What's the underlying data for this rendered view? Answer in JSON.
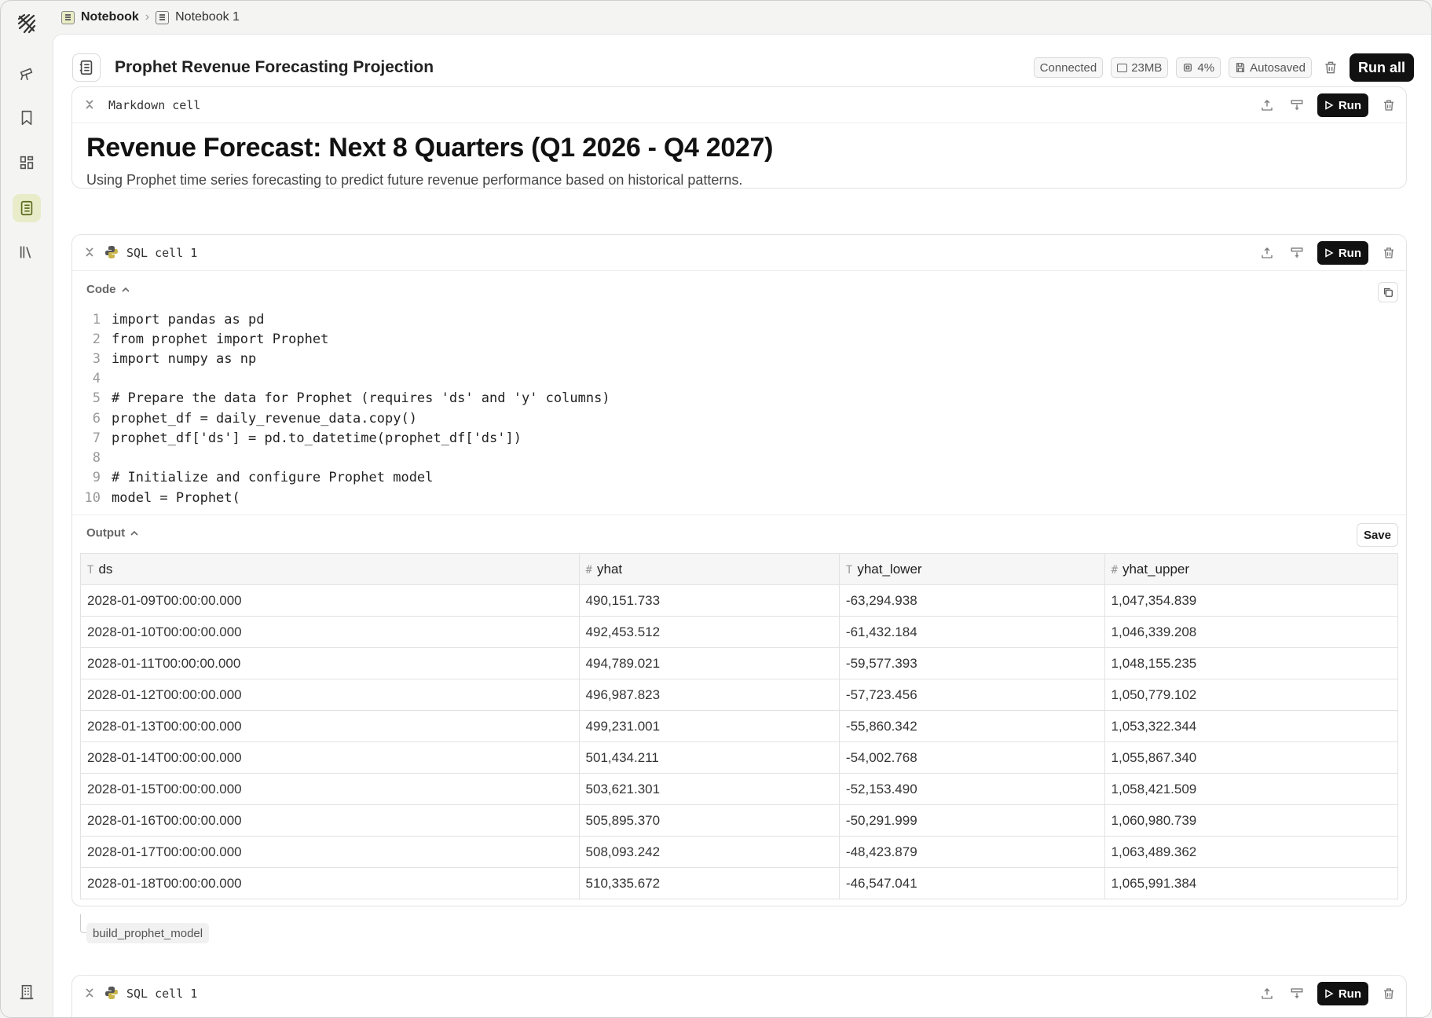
{
  "breadcrumb": {
    "root": "Notebook",
    "current": "Notebook 1"
  },
  "sidebar": {
    "items": [
      {
        "name": "telescope",
        "active": false
      },
      {
        "name": "bookmark",
        "active": false
      },
      {
        "name": "dashboard",
        "active": false
      },
      {
        "name": "notebook",
        "active": true
      },
      {
        "name": "library",
        "active": false
      }
    ],
    "bottom": "building"
  },
  "header": {
    "title": "Prophet Revenue Forecasting Projection",
    "status": "Connected",
    "memory": "23MB",
    "cpu": "4%",
    "save_state": "Autosaved",
    "run_all": "Run all"
  },
  "markdown_cell": {
    "name": "Markdown cell",
    "run": "Run",
    "heading": "Revenue Forecast: Next 8 Quarters (Q1 2026 - Q4 2027)",
    "paragraph": "Using Prophet time series forecasting to predict future revenue performance based on historical patterns."
  },
  "sql_cell": {
    "name": "SQL cell 1",
    "run": "Run",
    "code_label": "Code",
    "output_label": "Output",
    "save": "Save",
    "code": [
      {
        "n": "1",
        "t": "import pandas as pd"
      },
      {
        "n": "2",
        "t": "from prophet import Prophet"
      },
      {
        "n": "3",
        "t": "import numpy as np"
      },
      {
        "n": "4",
        "t": ""
      },
      {
        "n": "5",
        "t": "# Prepare the data for Prophet (requires 'ds' and 'y' columns)"
      },
      {
        "n": "6",
        "t": "prophet_df = daily_revenue_data.copy()"
      },
      {
        "n": "7",
        "t": "prophet_df['ds'] = pd.to_datetime(prophet_df['ds'])"
      },
      {
        "n": "8",
        "t": ""
      },
      {
        "n": "9",
        "t": "# Initialize and configure Prophet model"
      },
      {
        "n": "10",
        "t": "model = Prophet("
      }
    ],
    "columns": [
      {
        "type": "T",
        "name": "ds"
      },
      {
        "type": "#",
        "name": "yhat"
      },
      {
        "type": "T",
        "name": "yhat_lower"
      },
      {
        "type": "#",
        "name": "yhat_upper"
      }
    ],
    "rows": [
      [
        "2028-01-09T00:00:00.000",
        "490,151.733",
        "-63,294.938",
        "1,047,354.839"
      ],
      [
        "2028-01-10T00:00:00.000",
        "492,453.512",
        "-61,432.184",
        "1,046,339.208"
      ],
      [
        "2028-01-11T00:00:00.000",
        "494,789.021",
        "-59,577.393",
        "1,048,155.235"
      ],
      [
        "2028-01-12T00:00:00.000",
        "496,987.823",
        "-57,723.456",
        "1,050,779.102"
      ],
      [
        "2028-01-13T00:00:00.000",
        "499,231.001",
        "-55,860.342",
        "1,053,322.344"
      ],
      [
        "2028-01-14T00:00:00.000",
        "501,434.211",
        "-54,002.768",
        "1,055,867.340"
      ],
      [
        "2028-01-15T00:00:00.000",
        "503,621.301",
        "-52,153.490",
        "1,058,421.509"
      ],
      [
        "2028-01-16T00:00:00.000",
        "505,895.370",
        "-50,291.999",
        "1,060,980.739"
      ],
      [
        "2028-01-17T00:00:00.000",
        "508,093.242",
        "-48,423.879",
        "1,063,489.362"
      ],
      [
        "2028-01-18T00:00:00.000",
        "510,335.672",
        "-46,547.041",
        "1,065,991.384"
      ]
    ],
    "tag": "build_prophet_model"
  },
  "next_cell": {
    "name": "SQL cell 1",
    "run": "Run"
  }
}
